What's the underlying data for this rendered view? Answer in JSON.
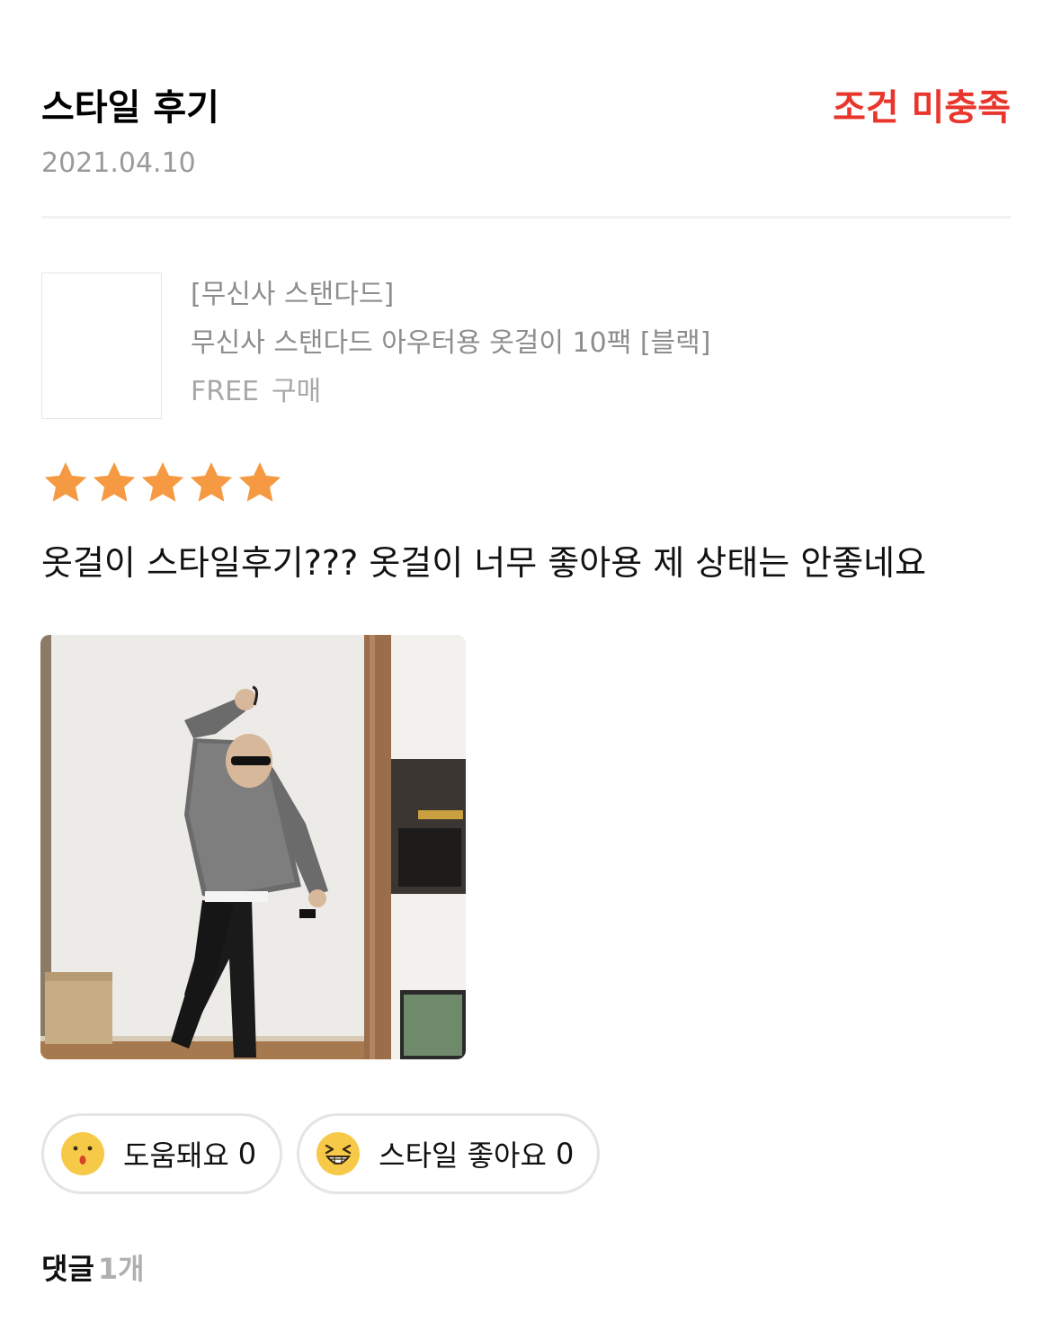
{
  "header": {
    "title": "스타일 후기",
    "status": "조건 미충족",
    "date": "2021.04.10"
  },
  "product": {
    "brand": "[무신사 스탠다드]",
    "name": "무신사 스탠다드 아우터용 옷걸이 10팩 [블랙]",
    "option": "FREE",
    "purchase": "구매"
  },
  "rating": {
    "value": 5,
    "max": 5,
    "star_color": "#f59a42"
  },
  "review": {
    "text": "옷걸이 스타일후기??? 옷걸이 너무 좋아용 제 상태는 안좋네요"
  },
  "reactions": {
    "helpful": {
      "label": "도움돼요",
      "count": "0",
      "icon": "surprised-face-icon"
    },
    "style_like": {
      "label": "스타일 좋아요",
      "count": "0",
      "icon": "grinning-face-icon"
    }
  },
  "comments": {
    "label": "댓글",
    "count": "1개"
  },
  "colors": {
    "status_red": "#e8362c",
    "emoji_yellow": "#f7c948"
  }
}
